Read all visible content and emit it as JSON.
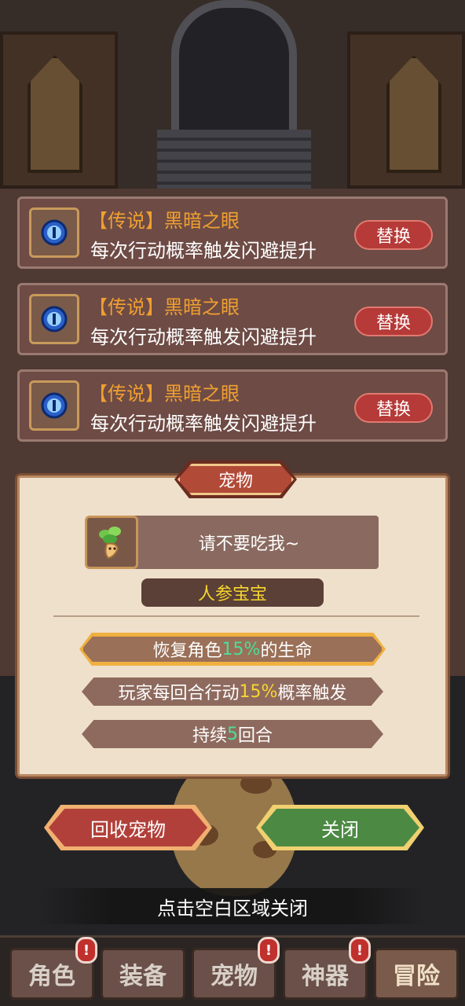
{
  "skills": [
    {
      "tag_open": "【",
      "rarity": "传说",
      "tag_close": "】",
      "name": "黑暗之眼",
      "desc": "每次行动概率触发闪避提升",
      "button": "替换",
      "icon": "blue-eye-orb-icon"
    },
    {
      "tag_open": "【",
      "rarity": "传说",
      "tag_close": "】",
      "name": "黑暗之眼",
      "desc": "每次行动概率触发闪避提升",
      "button": "替换",
      "icon": "blue-eye-orb-icon"
    },
    {
      "tag_open": "【",
      "rarity": "传说",
      "tag_close": "】",
      "name": "黑暗之眼",
      "desc": "每次行动概率触发闪避提升",
      "button": "替换",
      "icon": "blue-eye-orb-icon"
    }
  ],
  "pet_dialog": {
    "title": "宠物",
    "speech": "请不要吃我~",
    "avatar_icon": "ginseng-sprout-icon",
    "pet_name": "人参宝宝",
    "effects": [
      {
        "pre": "恢复角色",
        "highlight": "15%",
        "post": "的生命"
      },
      {
        "pre": "玩家每回合行动",
        "highlight": "15%",
        "post": "概率触发"
      },
      {
        "pre": "持续",
        "highlight": "5",
        "post": "回合"
      }
    ]
  },
  "buttons": {
    "recycle": "回收宠物",
    "close": "关闭"
  },
  "hint": "点击空白区域关闭",
  "tabs": [
    {
      "label": "角色",
      "badge": "!"
    },
    {
      "label": "装备",
      "badge": ""
    },
    {
      "label": "宠物",
      "badge": "!"
    },
    {
      "label": "神器",
      "badge": "!"
    },
    {
      "label": "冒险",
      "badge": ""
    }
  ],
  "colors": {
    "rarity": "#f0a030",
    "replace_button": "#b53a38",
    "pet_name": "#f8d62e",
    "highlight_green": "#4adf9a",
    "highlight_yellow": "#f8d62e",
    "close_button": "#4c8a44",
    "recycle_button": "#b2403a"
  }
}
